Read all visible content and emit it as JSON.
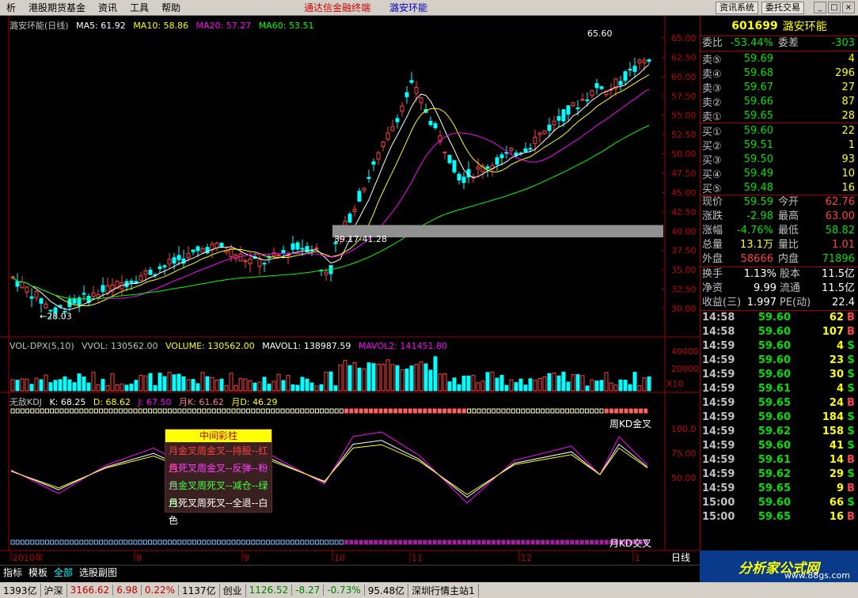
{
  "menu": {
    "items": [
      "析",
      "港股期货基金",
      "资讯",
      "工具",
      "帮助"
    ],
    "title": "通达信金融终端",
    "stock_title": "潞安环能",
    "buttons": [
      "资讯系统",
      "委托交易"
    ]
  },
  "chart": {
    "title": "潞安环能(日线)",
    "ma": [
      {
        "label": "MA5: 61.92",
        "color": "#ffffff"
      },
      {
        "label": "MA10: 58.86",
        "color": "#ffff00"
      },
      {
        "label": "MA20: 57.27",
        "color": "#ff00ff"
      },
      {
        "label": "MA60: 53.51",
        "color": "#00ff00"
      }
    ],
    "price_ticks": [
      "65.00",
      "62.50",
      "60.00",
      "57.50",
      "55.00",
      "52.50",
      "50.00",
      "47.50",
      "45.00",
      "42.50",
      "40.00",
      "37.50",
      "35.00",
      "32.50",
      "30.00"
    ],
    "annot_high": "65.60",
    "annot_low": "28.03",
    "annot_range": "39.17-41.28",
    "vol_legend": [
      {
        "label": "VOL-DPX(5,10)",
        "color": "#c0c0c0"
      },
      {
        "label": "VVOL: 130562.00",
        "color": "#c0c0c0"
      },
      {
        "label": "VOLUME: 130562.00",
        "color": "#ffff00"
      },
      {
        "label": "MAVOL1: 138987.59",
        "color": "#ffffff"
      },
      {
        "label": "MAVOL2: 141451.80",
        "color": "#ff00ff"
      }
    ],
    "vol_ticks": [
      "40000",
      "20000"
    ],
    "vol_unit": "X10",
    "kdj_legend": [
      {
        "label": "无敌KDJ",
        "color": "#c0c0c0"
      },
      {
        "label": "K: 68.25",
        "color": "#ffffff"
      },
      {
        "label": "D: 68.62",
        "color": "#ffff00"
      },
      {
        "label": "J: 67.50",
        "color": "#ff00ff"
      },
      {
        "label": "月K: 61.62",
        "color": "#ff8080"
      },
      {
        "label": "月D: 46.29",
        "color": "#ffff00"
      }
    ],
    "kdj_ticks": [
      "100.0",
      "75.00",
      "50.00"
    ],
    "kdj_label_top": "周KD金叉",
    "kdj_label_bottom": "月KD交叉",
    "info_box": {
      "title": "中间彩柱",
      "lines": [
        {
          "text": "月金叉周金叉--持股--红色",
          "color": "#ff4040"
        },
        {
          "text": "月死叉周金叉--反弹--粉色",
          "color": "#ff40ff"
        },
        {
          "text": "月金叉周死叉--减仓--绿色",
          "color": "#40ff40"
        },
        {
          "text": "月死叉周死叉--全退--白色",
          "color": "#ffffff"
        }
      ]
    },
    "x_labels": [
      "2010年",
      "8",
      "9",
      "10",
      "11",
      "12",
      "1"
    ],
    "period": "日线"
  },
  "quote": {
    "code": "601699",
    "name": "潞安环能",
    "weibi": {
      "label": "委比",
      "value": "-53.44%",
      "label2": "委差",
      "value2": "-303"
    },
    "sell": [
      {
        "label": "卖⑤",
        "price": "59.69",
        "vol": "4"
      },
      {
        "label": "卖④",
        "price": "59.68",
        "vol": "296"
      },
      {
        "label": "卖③",
        "price": "59.67",
        "vol": "27"
      },
      {
        "label": "卖②",
        "price": "59.66",
        "vol": "87"
      },
      {
        "label": "卖①",
        "price": "59.65",
        "vol": "28"
      }
    ],
    "buy": [
      {
        "label": "买①",
        "price": "59.60",
        "vol": "22"
      },
      {
        "label": "买②",
        "price": "59.51",
        "vol": "1"
      },
      {
        "label": "买③",
        "price": "59.50",
        "vol": "93"
      },
      {
        "label": "买④",
        "price": "59.49",
        "vol": "10"
      },
      {
        "label": "买⑤",
        "price": "59.48",
        "vol": "16"
      }
    ],
    "stats": [
      {
        "l1": "现价",
        "v1": "59.59",
        "c1": "#00e000",
        "l2": "今开",
        "v2": "62.76",
        "c2": "#ff4040"
      },
      {
        "l1": "涨跌",
        "v1": "-2.98",
        "c1": "#00e000",
        "l2": "最高",
        "v2": "63.00",
        "c2": "#ff4040"
      },
      {
        "l1": "涨幅",
        "v1": "-4.76%",
        "c1": "#00e000",
        "l2": "最低",
        "v2": "58.82",
        "c2": "#00e000"
      },
      {
        "l1": "总量",
        "v1": "13.1万",
        "c1": "#ffff00",
        "l2": "量比",
        "v2": "1.01",
        "c2": "#ff4040"
      },
      {
        "l1": "外盘",
        "v1": "58666",
        "c1": "#ff4040",
        "l2": "内盘",
        "v2": "71896",
        "c2": "#00e000"
      }
    ],
    "stats2": [
      {
        "l1": "换手",
        "v1": "1.13%",
        "l2": "股本",
        "v2": "11.5亿"
      },
      {
        "l1": "净资",
        "v1": "9.99",
        "l2": "流通",
        "v2": "11.5亿"
      },
      {
        "l1": "收益(三)",
        "v1": "1.997",
        "l2": "PE(动)",
        "v2": "22.4"
      }
    ],
    "ticks": [
      {
        "t": "14:58",
        "p": "59.60",
        "v": "62",
        "s": "B"
      },
      {
        "t": "14:58",
        "p": "59.60",
        "v": "107",
        "s": "B"
      },
      {
        "t": "14:59",
        "p": "59.60",
        "v": "4",
        "s": "S"
      },
      {
        "t": "14:59",
        "p": "59.60",
        "v": "23",
        "s": "S"
      },
      {
        "t": "14:59",
        "p": "59.60",
        "v": "30",
        "s": "S"
      },
      {
        "t": "14:59",
        "p": "59.61",
        "v": "4",
        "s": "S"
      },
      {
        "t": "14:59",
        "p": "59.65",
        "v": "24",
        "s": "B"
      },
      {
        "t": "14:59",
        "p": "59.60",
        "v": "184",
        "s": "S"
      },
      {
        "t": "14:59",
        "p": "59.62",
        "v": "158",
        "s": "S"
      },
      {
        "t": "14:59",
        "p": "59.60",
        "v": "41",
        "s": "S"
      },
      {
        "t": "14:59",
        "p": "59.61",
        "v": "14",
        "s": "B"
      },
      {
        "t": "14:59",
        "p": "59.62",
        "v": "29",
        "s": "S"
      },
      {
        "t": "14:59",
        "p": "59.65",
        "v": "9",
        "s": "B"
      },
      {
        "t": "15:00",
        "p": "59.60",
        "v": "66",
        "s": "S"
      },
      {
        "t": "15:00",
        "p": "59.65",
        "v": "16",
        "s": "B"
      }
    ]
  },
  "tabs": [
    "指标",
    "模板",
    "全部",
    "选股副图"
  ],
  "status": [
    {
      "text": "1393亿",
      "color": "#000"
    },
    {
      "text": "沪深",
      "color": "#000"
    },
    {
      "text": "3166.62",
      "color": "#c00000"
    },
    {
      "text": "6.98",
      "color": "#c00000"
    },
    {
      "text": "0.22%",
      "color": "#c00000"
    },
    {
      "text": "1137亿",
      "color": "#000"
    },
    {
      "text": "创业",
      "color": "#000"
    },
    {
      "text": "1126.52",
      "color": "#008000"
    },
    {
      "text": "-8.27",
      "color": "#008000"
    },
    {
      "text": "-0.73%",
      "color": "#008000"
    },
    {
      "text": "95.48亿",
      "color": "#000"
    },
    {
      "text": "深圳行情主站1",
      "color": "#000"
    }
  ],
  "logo": {
    "text": "分析家公式网",
    "url": "www.88gs.com"
  }
}
